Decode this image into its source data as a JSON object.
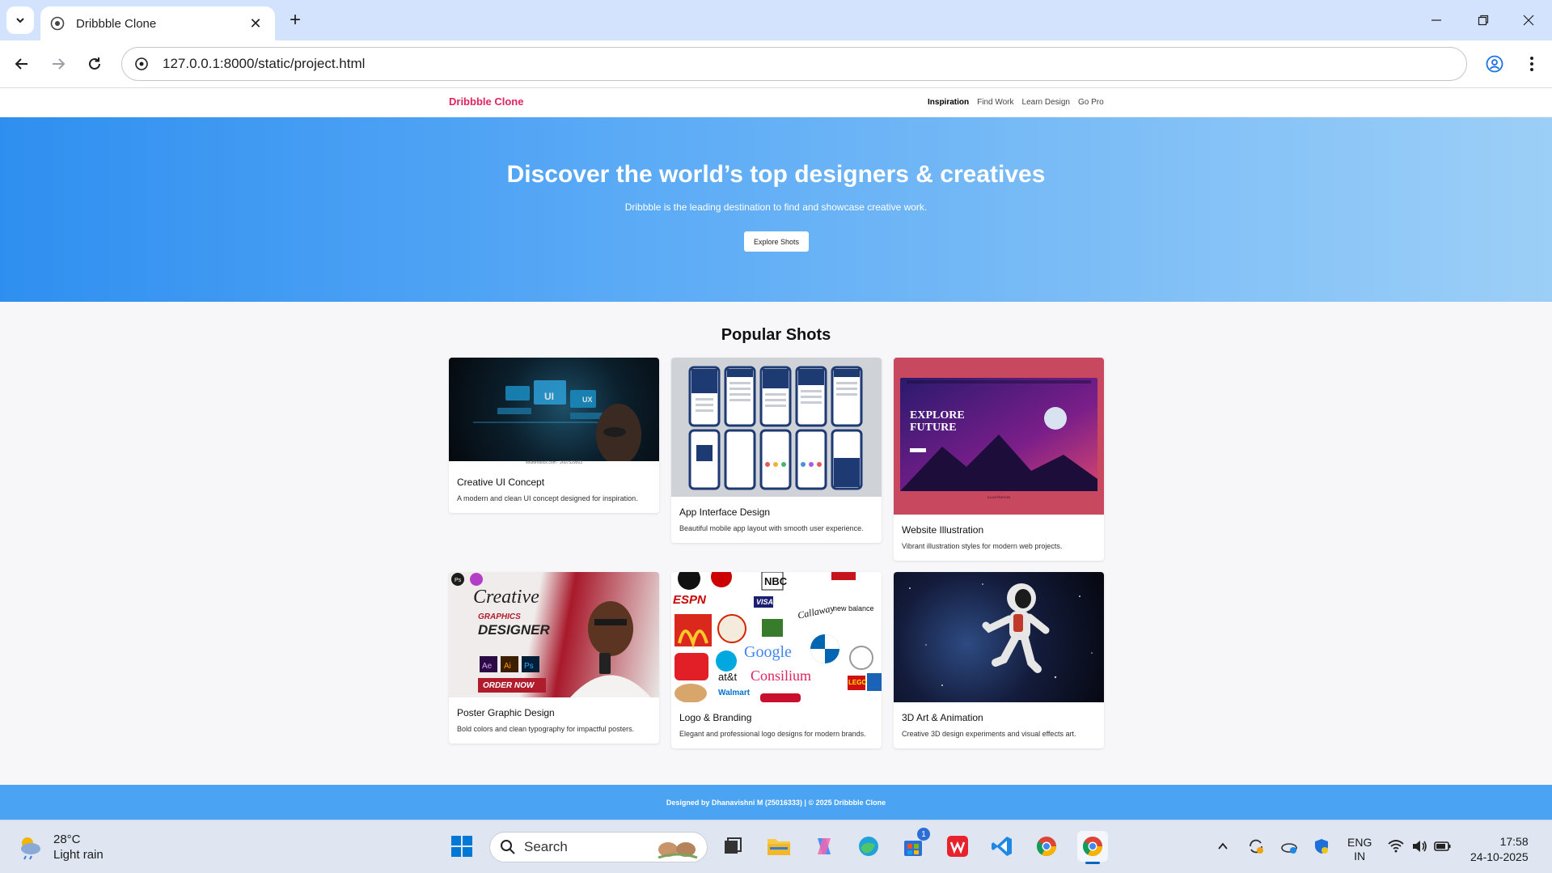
{
  "browser": {
    "tab_title": "Dribbble Clone",
    "url": "127.0.0.1:8000/static/project.html"
  },
  "site": {
    "logo": "Dribbble Clone",
    "nav": [
      "Inspiration",
      "Find Work",
      "Learn Design",
      "Go Pro"
    ],
    "hero": {
      "title": "Discover the world’s top designers & creatives",
      "subtitle": "Dribbble is the leading destination to find and showcase creative work.",
      "cta": "Explore Shots"
    },
    "section_title": "Popular Shots",
    "cards": [
      {
        "title": "Creative UI Concept",
        "desc": "A modern and clean UI concept designed for inspiration.",
        "thumb_caption": "shutterstock.com · 2607529503"
      },
      {
        "title": "App Interface Design",
        "desc": "Beautiful mobile app layout with smooth user experience."
      },
      {
        "title": "Website Illustration",
        "desc": "Vibrant illustration styles for modern web projects.",
        "thumb_text": "EXPLORE FUTURE"
      },
      {
        "title": "Poster Graphic Design",
        "desc": "Bold colors and clean typography for impactful posters.",
        "thumb_text": [
          "Creative",
          "GRAPHICS",
          "DESIGNER",
          "ORDER NOW"
        ]
      },
      {
        "title": "Logo & Branding",
        "desc": "Elegant and professional logo designs for modern brands.",
        "thumb_logos": [
          "ESPN",
          "NBC",
          "VISA",
          "Callaway",
          "new balance",
          "Google",
          "at&t",
          "Consilium",
          "Walmart",
          "LEGO"
        ]
      },
      {
        "title": "3D Art & Animation",
        "desc": "Creative 3D design experiments and visual effects art."
      }
    ],
    "footer": "Designed by Dhanavishni M (25016333) | © 2025 Dribbble Clone"
  },
  "taskbar": {
    "weather_temp": "28°C",
    "weather_desc": "Light rain",
    "search_label": "Search",
    "lang_top": "ENG",
    "lang_bottom": "IN",
    "time": "17:58",
    "date": "24-10-2025",
    "badge": "1"
  },
  "colors": {
    "accent": "#e0245e",
    "hero_start": "#2f8ff0",
    "hero_end": "#9ccff7",
    "footer": "#4aa3f3"
  }
}
